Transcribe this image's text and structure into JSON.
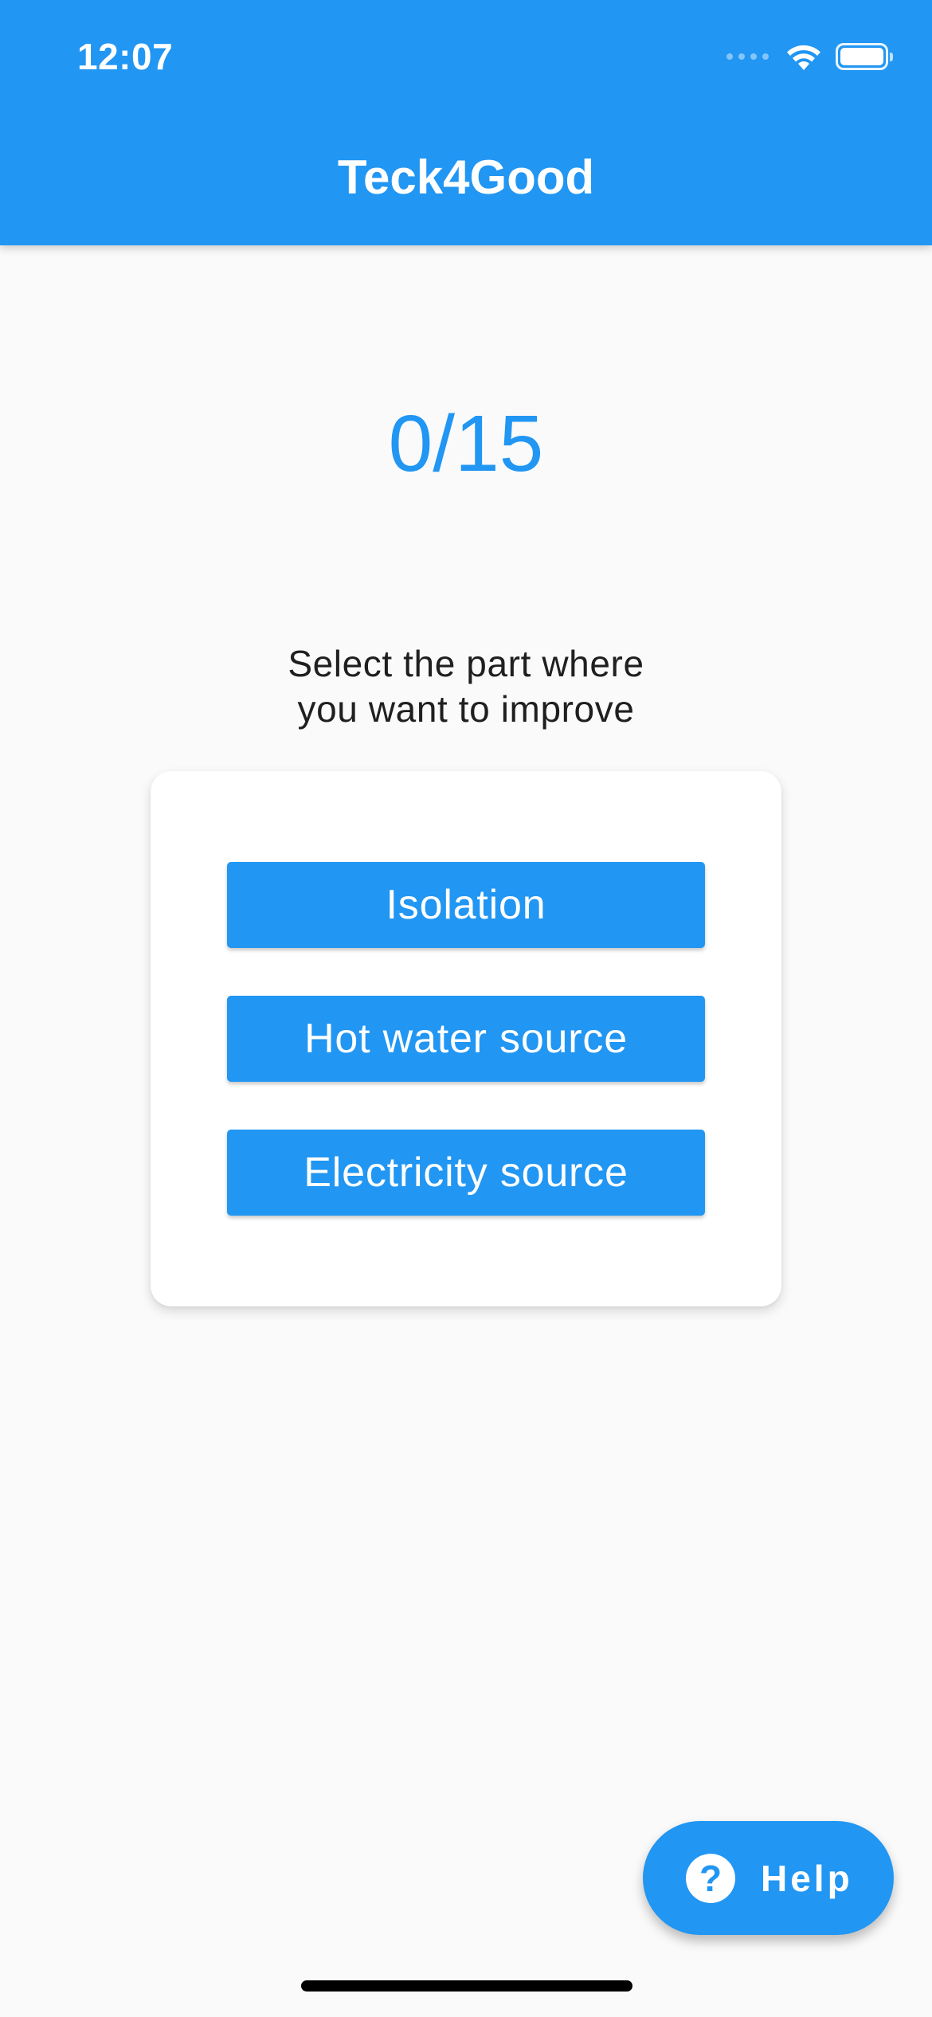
{
  "status_bar": {
    "time": "12:07",
    "icons": [
      "cellular-signal-icon",
      "wifi-icon",
      "battery-icon"
    ]
  },
  "app_bar": {
    "title": "Teck4Good"
  },
  "progress": {
    "score_text": "0/15"
  },
  "instruction": {
    "line1": "Select the part where",
    "line2": "you want to improve"
  },
  "options": [
    {
      "label": "Isolation"
    },
    {
      "label": "Hot water source"
    },
    {
      "label": "Electricity source"
    }
  ],
  "help_button": {
    "icon": "help-circle-icon",
    "label": "Help"
  },
  "colors": {
    "primary": "#2196f3",
    "background": "#fafafa",
    "card": "#ffffff",
    "text_dark": "#1f1f1f"
  }
}
